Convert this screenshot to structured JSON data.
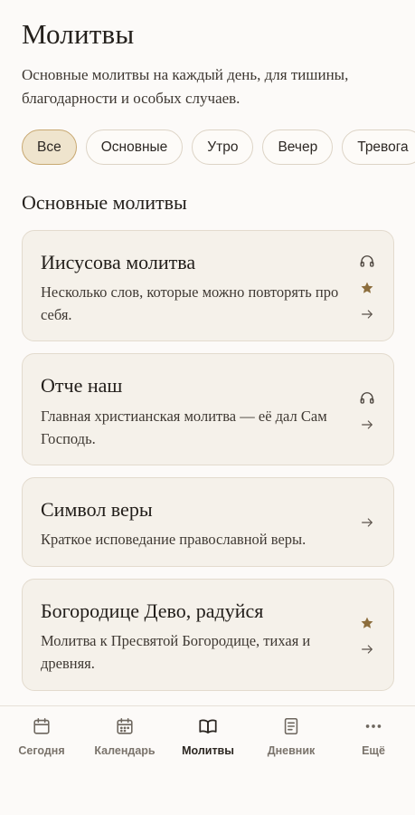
{
  "header": {
    "title": "Молитвы",
    "subtitle": "Основные молитвы на каждый день, для тишины, благодарности и особых случаев."
  },
  "filters": [
    {
      "label": "Все",
      "active": true
    },
    {
      "label": "Основные",
      "active": false
    },
    {
      "label": "Утро",
      "active": false
    },
    {
      "label": "Вечер",
      "active": false
    },
    {
      "label": "Тревога",
      "active": false
    }
  ],
  "section": {
    "title": "Основные молитвы"
  },
  "prayers": [
    {
      "title": "Иисусова молитва",
      "description": "Несколько слов, которые можно повторять про себя.",
      "icons": [
        "headphones-icon",
        "star-icon",
        "arrow-right-icon"
      ]
    },
    {
      "title": "Отче наш",
      "description": "Главная христианская молитва — её дал Сам Господь.",
      "icons": [
        "headphones-icon",
        "arrow-right-icon"
      ]
    },
    {
      "title": "Символ веры",
      "description": "Краткое исповедание православной веры.",
      "icons": [
        "arrow-right-icon"
      ]
    },
    {
      "title": "Богородице Дево, радуйся",
      "description": "Молитва к Пресвятой Богородице, тихая и древняя.",
      "icons": [
        "star-icon",
        "arrow-right-icon"
      ]
    }
  ],
  "tabbar": [
    {
      "label": "Сегодня",
      "icon": "calendar-day-icon",
      "active": false
    },
    {
      "label": "Календарь",
      "icon": "calendar-icon",
      "active": false
    },
    {
      "label": "Молитвы",
      "icon": "book-open-icon",
      "active": true
    },
    {
      "label": "Дневник",
      "icon": "journal-icon",
      "active": false
    },
    {
      "label": "Ещё",
      "icon": "more-icon",
      "active": false
    }
  ],
  "colors": {
    "background": "#fcfaf8",
    "card": "#f5f1ea",
    "accent_gold": "#8c6d3c",
    "chip_active": "#efe4cd"
  }
}
